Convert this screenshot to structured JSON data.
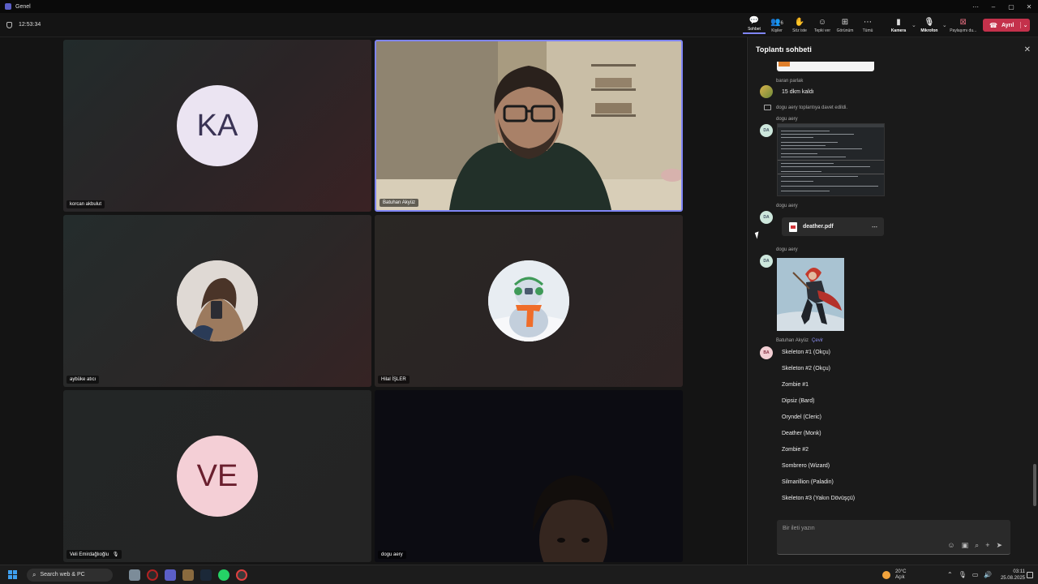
{
  "window": {
    "title": "Genel",
    "controls": [
      "⋯",
      "–",
      "▢",
      "✕"
    ]
  },
  "meeting": {
    "timer": "12:53:34"
  },
  "toolbar": {
    "chat_label": "Sohbet",
    "people_label": "Kişiler",
    "people_count": "6",
    "raise_label": "Söz iste",
    "react_label": "Tepki ver",
    "view_label": "Görünüm",
    "more_label": "Tümü",
    "camera_label": "Kamera",
    "mic_label": "Mikrofon",
    "share_label": "Paylaşımı du...",
    "leave_label": "Ayrıl"
  },
  "participants": [
    {
      "name": "korcan akbulut",
      "initials": "KA",
      "avatar_bg": "#ebe4f2",
      "avatar_fg": "#3a3355"
    },
    {
      "name": "Batuhan Akyüz",
      "video": true
    },
    {
      "name": "aybüke atıcı",
      "avatar": "photo"
    },
    {
      "name": "Hilal İŞLER",
      "avatar": "snowman"
    },
    {
      "name": "Veli Emirdağlıoğlu",
      "initials": "VE",
      "avatar_bg": "#f4cfd6",
      "avatar_fg": "#6a1f2e",
      "muted": true
    },
    {
      "name": "dogu aery",
      "video": true
    }
  ],
  "chat": {
    "title": "Toplantı sohbeti",
    "messages": {
      "m1_sender": "baran parlak",
      "m1_text": "15 dkm kaldı",
      "system_text": "dogu aery toplantıya davet edildi.",
      "m2_sender": "dogu aery",
      "m3_sender": "dogu aery",
      "m3_file": "deather.pdf",
      "m4_sender": "dogu aery",
      "m5_sender": "Batuhan Akyüz",
      "m5_translate": "Çevir",
      "da_initials": "DA",
      "ba_initials": "BA"
    },
    "list_lines": [
      "Skeleton #1 (Okçu)",
      "Skeleton #2 (Okçu)",
      "Zombie #1",
      "Dipsiz (Bard)",
      "Oryndel (Cleric)",
      "Deather (Monk)",
      "Zombie #2",
      "Sombrero (Wizard)",
      "Silmarillion (Paladin)",
      "Skeleton #3 (Yakın Dövüşçü)"
    ],
    "compose_placeholder": "Bir ileti yazın"
  },
  "taskbar": {
    "search_text": "Search web & PC",
    "temperature": "20°C",
    "weather": "Açık",
    "time": "03:11",
    "date": "25.08.2025"
  }
}
